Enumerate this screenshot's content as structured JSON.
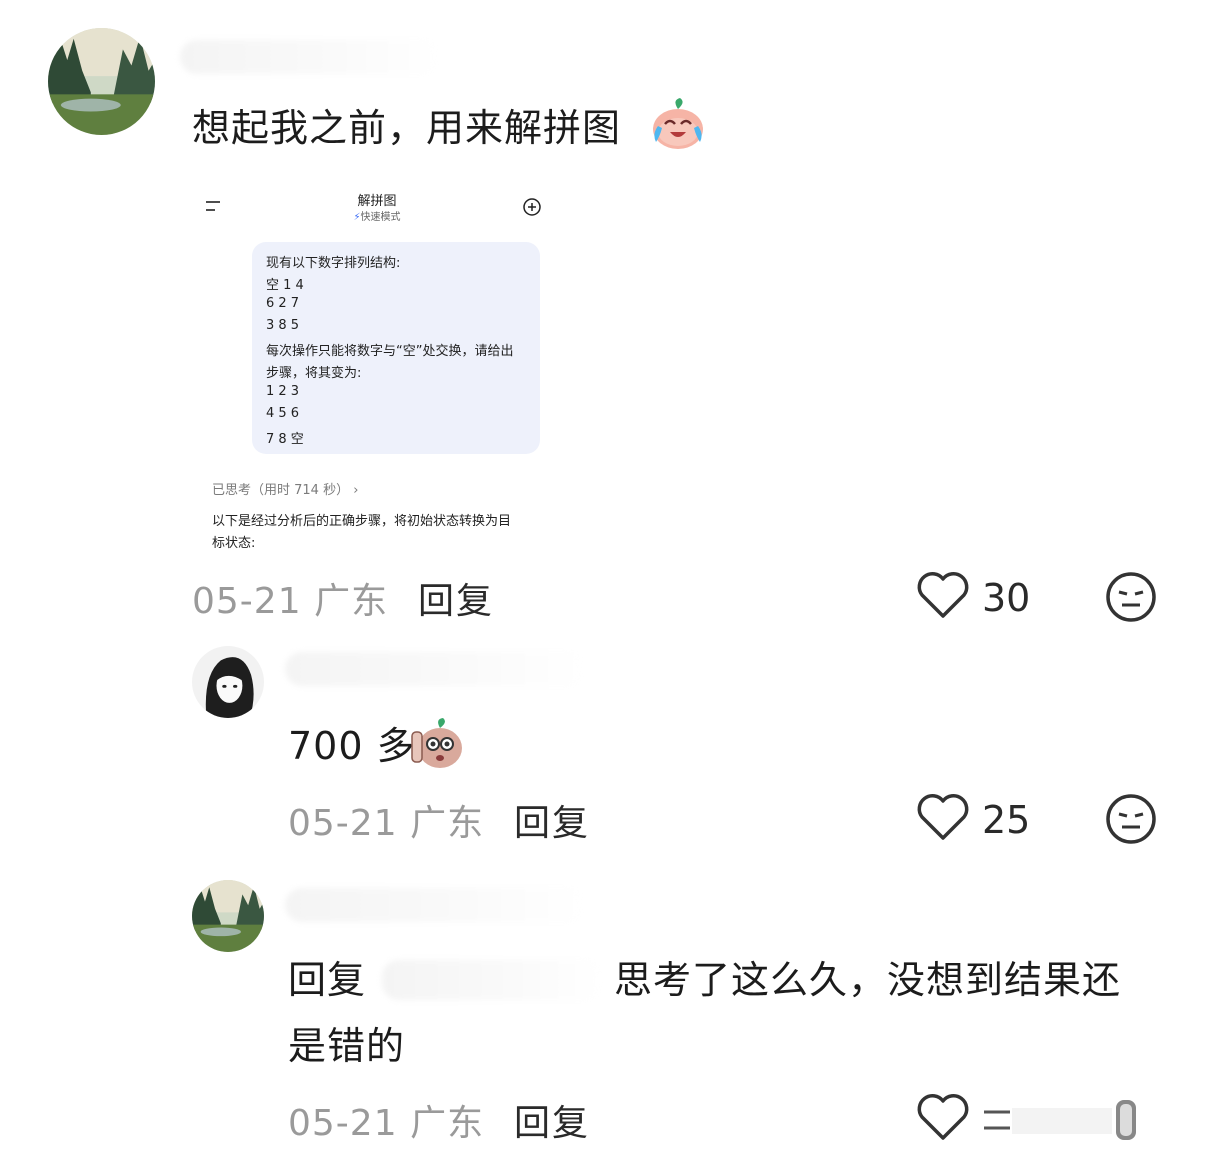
{
  "comments": [
    {
      "text": "想起我之前，用来解拼图",
      "emoji_icon": "crying-laughing-peach-emoji",
      "date": "05-21",
      "location": "广东",
      "reply_label": "回复",
      "likes": "30",
      "screenshot": {
        "title": "解拼图",
        "subtitle": "快速模式",
        "question_lines": [
          "现有以下数字排列结构:",
          "空 1 4",
          "6 2 7",
          "3 8 5",
          "每次操作只能将数字与“空”处交换，请给出",
          "步骤，将其变为:",
          "1 2 3",
          "4 5 6",
          "7 8 空"
        ],
        "thinking": "已思考（用时 714 秒）",
        "answer_lines": [
          "以下是经过分析后的正确步骤，将初始状态转换为目",
          "标状态:"
        ]
      }
    },
    {
      "text": "700 多",
      "emoji_icon": "peeking-peach-emoji",
      "date": "05-21",
      "location": "广东",
      "reply_label": "回复",
      "likes": "25"
    },
    {
      "text_prefix": "回复",
      "text_main": "思考了这么久，没想到结果还",
      "text_line2": "是错的",
      "date": "05-21",
      "location": "广东",
      "reply_label": "回复"
    }
  ],
  "colors": {
    "meta": "#9a9a9a",
    "bubble": "#eef1fb",
    "accent": "#3b6cf6"
  }
}
